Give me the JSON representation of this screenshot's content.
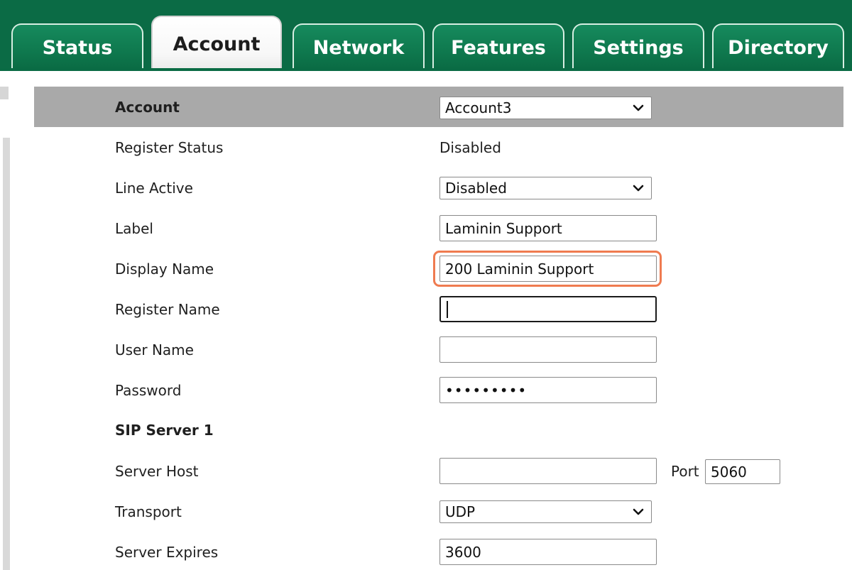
{
  "tabs": [
    {
      "label": "Status"
    },
    {
      "label": "Account",
      "active": true
    },
    {
      "label": "Network"
    },
    {
      "label": "Features"
    },
    {
      "label": "Settings"
    },
    {
      "label": "Directory"
    }
  ],
  "form": {
    "account": {
      "label": "Account",
      "value": "Account3"
    },
    "register_status": {
      "label": "Register Status",
      "value": "Disabled"
    },
    "line_active": {
      "label": "Line Active",
      "value": "Disabled"
    },
    "label_field": {
      "label": "Label",
      "value": "Laminin Support"
    },
    "display_name": {
      "label": "Display Name",
      "value": "200 Laminin Support"
    },
    "register_name": {
      "label": "Register Name",
      "value": ""
    },
    "user_name": {
      "label": "User Name",
      "value": ""
    },
    "password": {
      "label": "Password",
      "value": "•••••••••"
    },
    "sip_server_heading": "SIP Server 1",
    "server_host": {
      "label": "Server Host",
      "value": "",
      "port_label": "Port",
      "port_value": "5060"
    },
    "transport": {
      "label": "Transport",
      "value": "UDP"
    },
    "server_expires": {
      "label": "Server Expires",
      "value": "3600"
    }
  },
  "colors": {
    "brand_green": "#0b6b45",
    "highlight": "#ef7b50",
    "header_gray": "#a9a9a9"
  }
}
